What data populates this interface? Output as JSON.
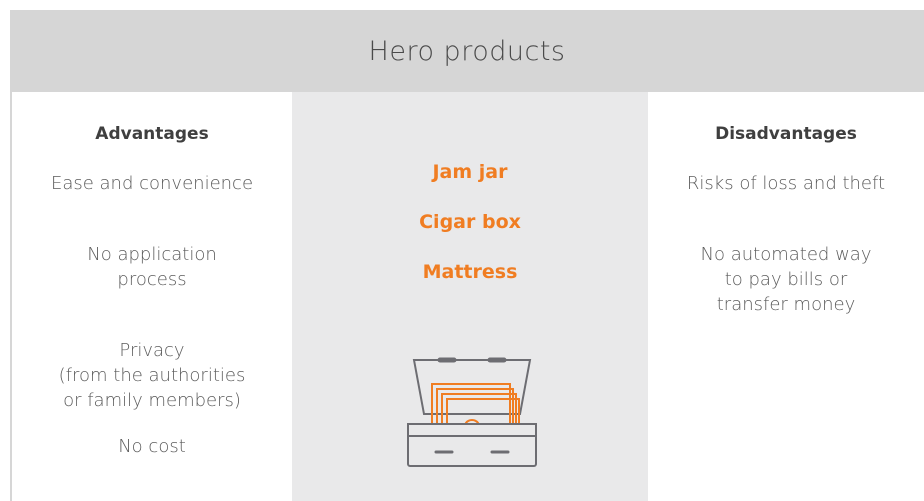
{
  "header": {
    "title": "Hero products"
  },
  "advantages": {
    "heading": "Advantages",
    "items": [
      "Ease and convenience",
      "No application\nprocess",
      "Privacy\n(from the authorities\nor family members)",
      "No cost"
    ]
  },
  "products": {
    "items": [
      "Jam jar",
      "Cigar box",
      "Mattress"
    ],
    "accent_color": "#f07d22",
    "illustration_icon": "cash-box-icon"
  },
  "disadvantages": {
    "heading": "Disadvantages",
    "items": [
      "Risks of loss and theft",
      "No automated way\nto pay bills or\ntransfer money"
    ]
  },
  "colors": {
    "header_bg": "#d6d6d6",
    "middle_bg": "#e9e9ea",
    "text": "#5b5b5b"
  }
}
